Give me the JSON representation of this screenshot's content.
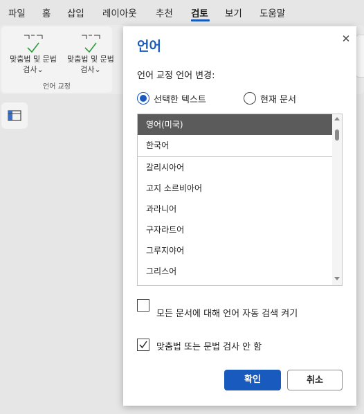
{
  "menubar": {
    "items": [
      {
        "label": "파일"
      },
      {
        "label": "홈"
      },
      {
        "label": "삽입"
      },
      {
        "label": "레이아웃"
      },
      {
        "label": "추천"
      },
      {
        "label": "검토",
        "active": true
      },
      {
        "label": "보기"
      },
      {
        "label": "도움말"
      }
    ]
  },
  "ribbon": {
    "buttons": [
      {
        "label_line1": "맞춤법 및 문법",
        "label_line2": "검사",
        "icon": "spellcheck-icon"
      },
      {
        "label_line1": "맞춤법 및 문법",
        "label_line2": "검사",
        "icon": "spellcheck-icon"
      }
    ],
    "group_label": "언어 교정",
    "nav_icon": "navigation-pane-icon"
  },
  "dialog": {
    "title": "언어",
    "close_icon": "close-icon",
    "section_label": "언어 교정 언어 변경:",
    "radio_selected": {
      "label": "선택한 텍스트",
      "checked": true
    },
    "radio_document": {
      "label": "현재 문서",
      "checked": false
    },
    "languages": [
      {
        "label": "영어(미국)",
        "selected": true
      },
      {
        "label": "한국어",
        "selected": false
      },
      {
        "label": "갈리시아어",
        "selected": false
      },
      {
        "label": "고지 소르비아어",
        "selected": false
      },
      {
        "label": "과라니어",
        "selected": false
      },
      {
        "label": "구자라트어",
        "selected": false
      },
      {
        "label": "그루지야어",
        "selected": false
      },
      {
        "label": "그리스어",
        "selected": false
      }
    ],
    "auto_detect": {
      "label": "모든 문서에 대해 언어 자동 검색 켜기",
      "checked": false
    },
    "no_spellcheck": {
      "label": "맞춤법 또는 문법 검사 안 함",
      "checked": true
    },
    "ok_label": "확인",
    "cancel_label": "취소",
    "accent_color": "#185abd"
  }
}
